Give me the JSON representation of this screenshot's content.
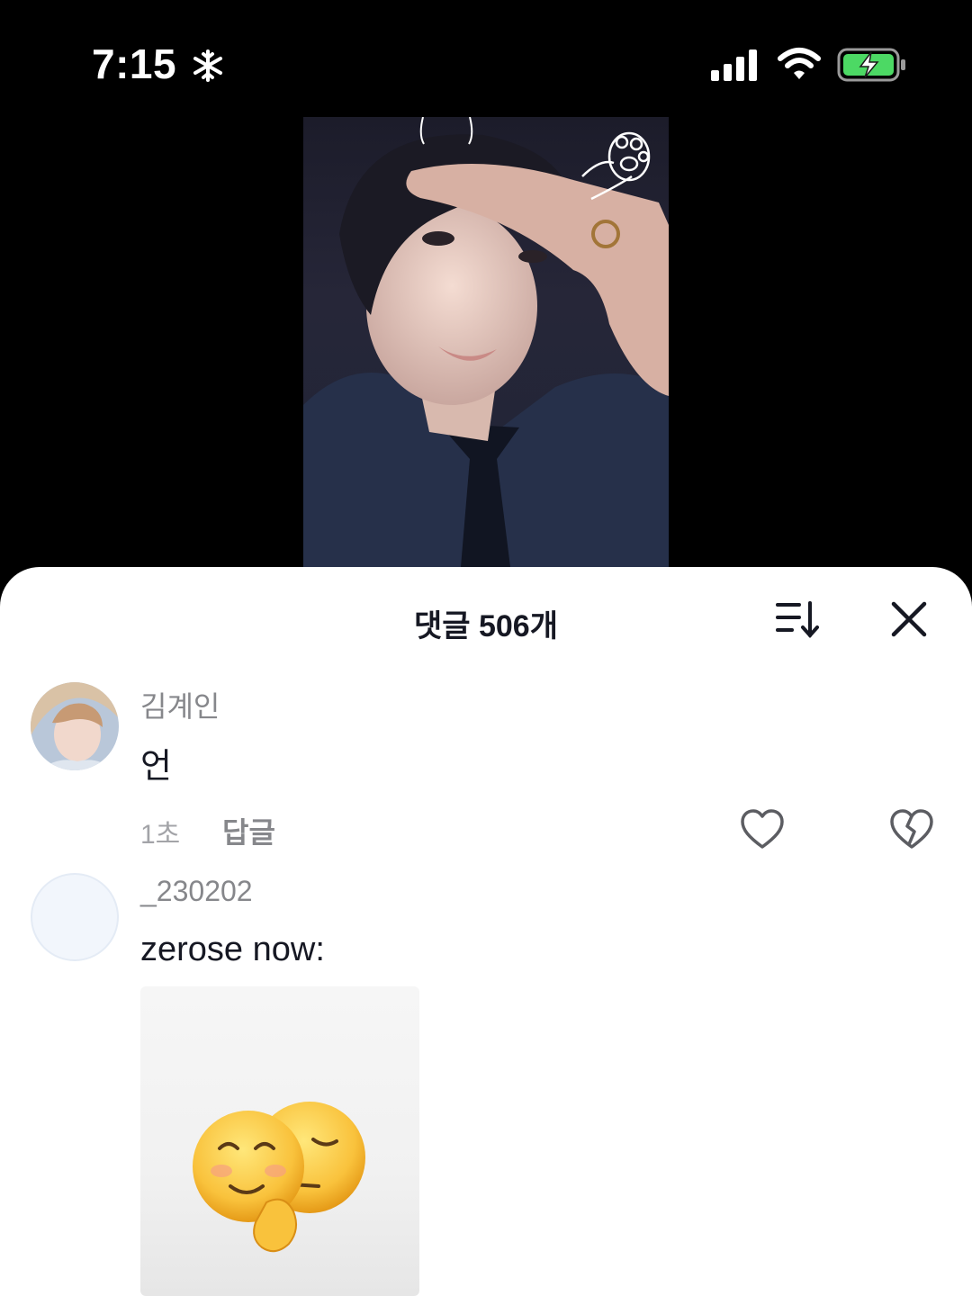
{
  "status_bar": {
    "time": "7:15",
    "focus_icon": "snowflake-icon",
    "signal_icon": "cellular-signal-icon",
    "wifi_icon": "wifi-icon",
    "battery_icon": "battery-charging-icon",
    "battery_color": "#4cd964"
  },
  "video": {
    "icon": "cat-paw-icon"
  },
  "comments": {
    "title": "댓글 506개",
    "sort_icon": "sort-icon",
    "close_icon": "close-icon",
    "items": [
      {
        "username": "김계인",
        "text": "언",
        "time": "1초",
        "reply_label": "답글",
        "like_icon": "heart-icon",
        "dislike_icon": "broken-heart-icon"
      },
      {
        "username": "_230202",
        "text": "zerose now:",
        "sticker": "two-faced-emoji-sticker"
      }
    ]
  }
}
